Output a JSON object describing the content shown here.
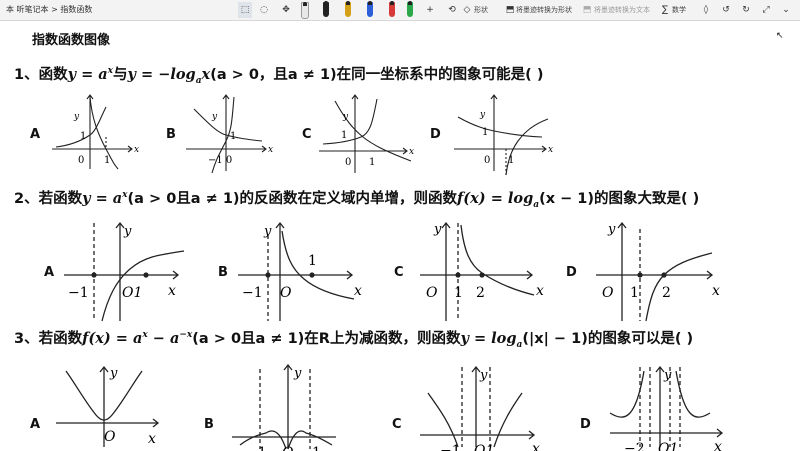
{
  "app": {
    "breadcrumb": "本 听笔记本 > 指数函数",
    "toolbar": {
      "shape_label": "形状",
      "ink_to_shape_label": "将墨迹转换为形状",
      "ink_to_text_label": "将墨迹转换为文本",
      "math_label": "数学"
    }
  },
  "page": {
    "title": "指数函数图像",
    "questions": [
      {
        "prefix": "1、函数",
        "m1": "y = a",
        "m1sup": "x",
        "t1": "与",
        "m2": "y = −log",
        "m2sub": "a",
        "m3": "x",
        "t2": "(a > 0，且a ≠ 1)在同一坐标系中的图象可能是(     )",
        "options": [
          "A",
          "B",
          "C",
          "D"
        ]
      },
      {
        "prefix": "2、若函数",
        "m1": "y = a",
        "m1sup": "x",
        "t1": "(a > 0且a ≠ 1)的反函数在定义域内单增，则函数",
        "m2": "f(x) = log",
        "m2sub": "a",
        "t2": "(x − 1)的图象大致是(     )",
        "options": [
          "A",
          "B",
          "C",
          "D"
        ]
      },
      {
        "prefix": "3、若函数",
        "m1": "f(x) = a",
        "m1sup": "x",
        "m1b": " − a",
        "m1bsup": "−x",
        "t1": "(a > 0且a ≠ 1)在R上为减函数，则函数",
        "m2": "y = log",
        "m2sub": "a",
        "t2": "(|x| − 1)的图象可以是(     )",
        "options": [
          "A",
          "B",
          "C",
          "D"
        ]
      }
    ],
    "graph_labels": {
      "y": "y",
      "x": "x",
      "o": "O",
      "zero": "0",
      "one": "1",
      "neg_one": "−1",
      "two": "2",
      "neg_two": "−2",
      "neg_one_zero": "−1 0",
      "o1": "O1"
    }
  }
}
